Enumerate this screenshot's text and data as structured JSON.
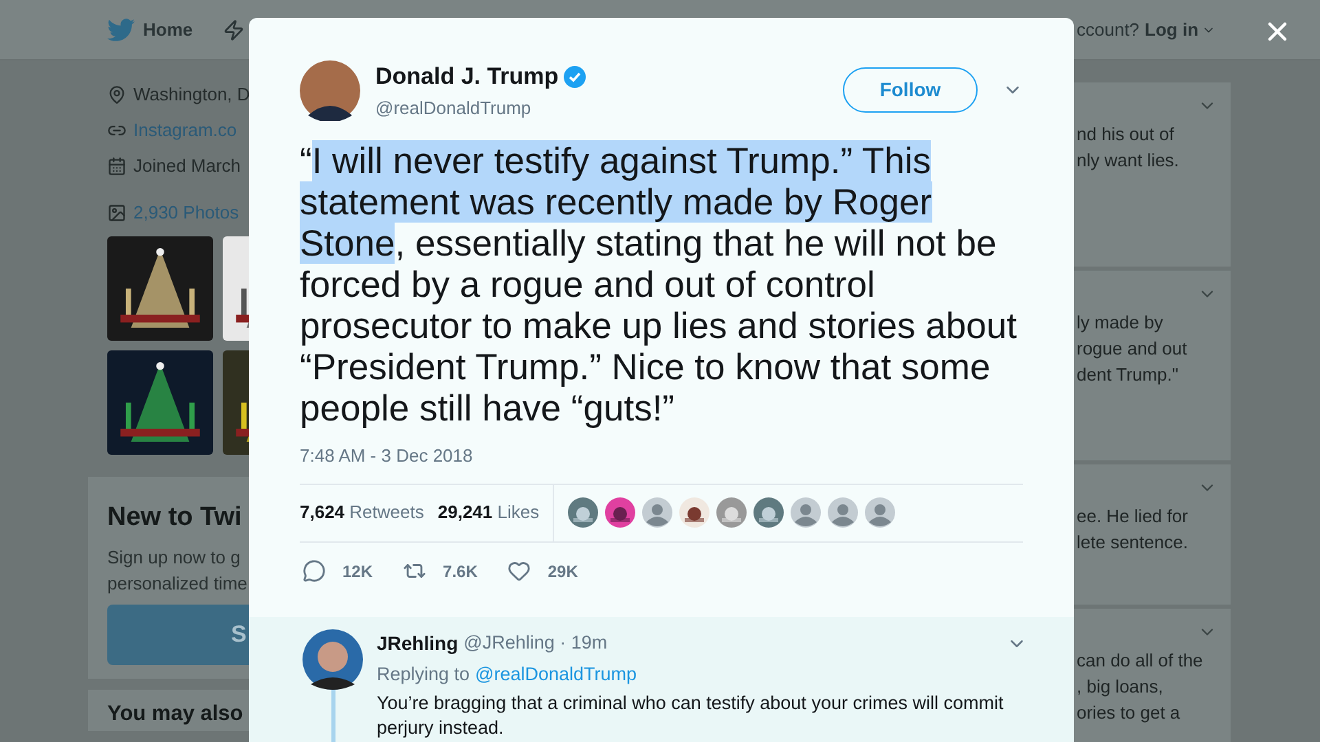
{
  "nav": {
    "home": "Home",
    "account_prompt": "ccount?",
    "login": "Log in"
  },
  "profile": {
    "location": "Washington, D",
    "link": "Instagram.co",
    "joined": "Joined March",
    "photos": "2,930 Photos"
  },
  "photo_grid": [
    {
      "kind": "picture"
    },
    {
      "kind": "picture"
    },
    {
      "kind": "picture"
    },
    {
      "kind": "picture"
    }
  ],
  "signup": {
    "title": "New to Twi",
    "lines": [
      "Sign up now to g",
      "personalized time"
    ],
    "button": "S"
  },
  "suggestions": {
    "title": "You may also"
  },
  "feed": [
    {
      "lines": [
        "nd his out of",
        "nly want lies."
      ]
    },
    {
      "lines": [
        "ly made by",
        "rogue and out",
        "dent Trump.\""
      ]
    },
    {
      "lines": [
        "ee. He lied for",
        "lete sentence."
      ]
    },
    {
      "lines": [
        "can do all of the",
        ", big loans,",
        "ories to get a"
      ]
    }
  ],
  "tweet": {
    "name": "Donald J. Trump",
    "verified": true,
    "handle": "@realDonaldTrump",
    "follow": "Follow",
    "segments": [
      {
        "text": "“",
        "selected": false
      },
      {
        "text": "I will never testify against Trump.” This statement was recently made by Roger Stone",
        "selected": true
      },
      {
        "text": ", essentially stating that he will not be forced by a rogue and out of control prosecutor to make up lies and stories about “President Trump.” Nice to know that some people still have “guts!”",
        "selected": false
      }
    ],
    "timestamp": "7:48 AM - 3 Dec 2018",
    "retweets": "7,624",
    "retweets_label": "Retweets",
    "likes": "29,241",
    "likes_label": "Likes",
    "likers": [
      {
        "kind": "picture"
      },
      {
        "kind": "picture"
      },
      {
        "kind": "default"
      },
      {
        "kind": "picture"
      },
      {
        "kind": "picture"
      },
      {
        "kind": "picture"
      },
      {
        "kind": "default"
      },
      {
        "kind": "default"
      },
      {
        "kind": "default"
      }
    ],
    "actions": [
      {
        "kind": "reply",
        "count": "12K"
      },
      {
        "kind": "retweet",
        "count": "7.6K"
      },
      {
        "kind": "like",
        "count": "29K"
      }
    ]
  },
  "reply": {
    "name": "JRehling",
    "meta": "@JRehling · 19m",
    "replying_to": "Replying to",
    "mention": "@realDonaldTrump",
    "text": "You’re bragging that a criminal who can testify about your crimes will commit perjury instead."
  }
}
